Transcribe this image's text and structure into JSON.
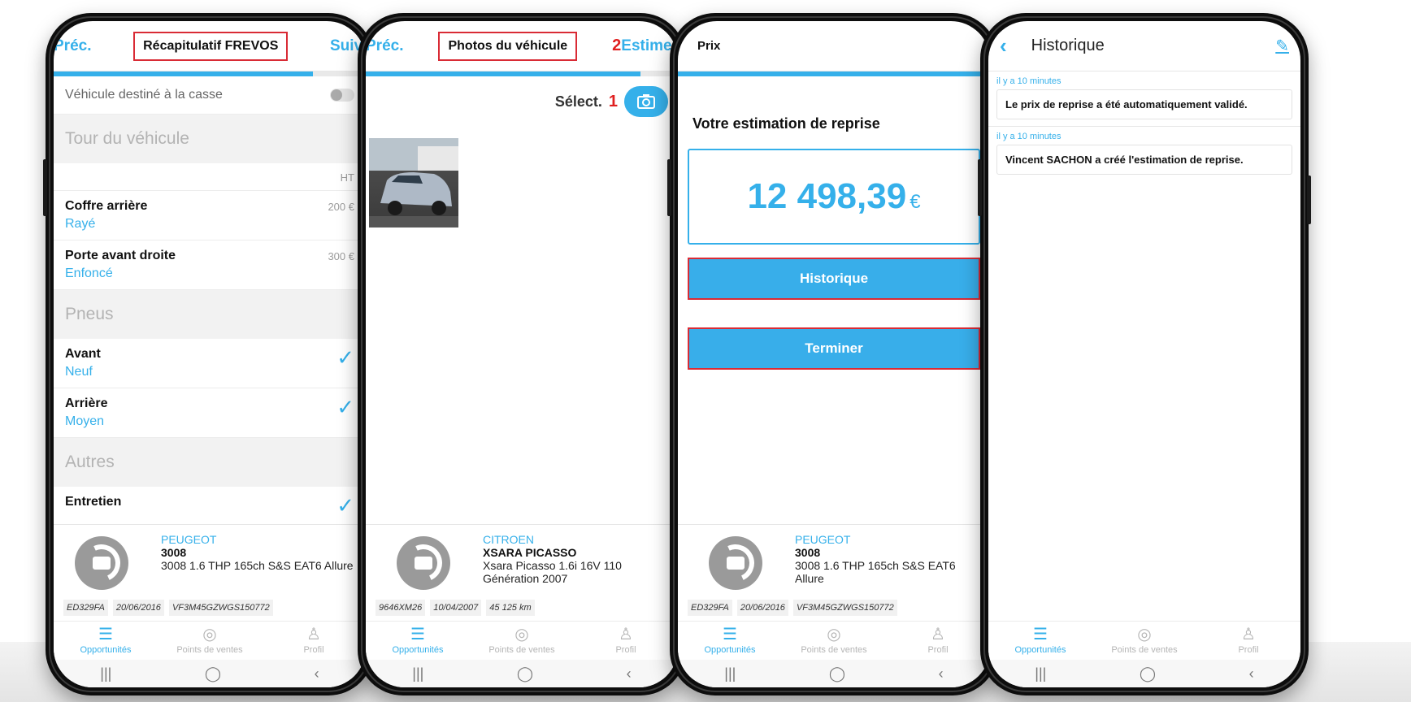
{
  "phone1": {
    "prev": "Préc.",
    "title": "Récapitulatif FREVOS",
    "next": "Suiv.",
    "toggle_label": "Véhicule destiné à la casse",
    "section_tour": "Tour du véhicule",
    "ht": "HT",
    "items": [
      {
        "title": "Coffre arrière",
        "status": "Rayé",
        "price": "200 €"
      },
      {
        "title": "Porte avant droite",
        "status": "Enfoncé",
        "price": "300 €"
      }
    ],
    "section_pneus": "Pneus",
    "pneus": [
      {
        "title": "Avant",
        "status": "Neuf"
      },
      {
        "title": "Arrière",
        "status": "Moyen"
      }
    ],
    "section_autres": "Autres",
    "autres": [
      {
        "title": "Entretien"
      }
    ],
    "vehicle": {
      "brand": "PEUGEOT",
      "model": "3008",
      "desc": "3008 1.6 THP 165ch S&S EAT6 Allure",
      "plate": "ED329FA",
      "date": "20/06/2016",
      "vin": "VF3M45GZWGS150772"
    },
    "progress": 0.83
  },
  "phone2": {
    "prev": "Préc.",
    "title": "Photos du véhicule",
    "step_next": "2",
    "next": "Estimer",
    "select_label": "Sélect.",
    "step_select": "1",
    "vehicle": {
      "brand": "CITROEN",
      "model": "XSARA PICASSO",
      "desc": "Xsara Picasso 1.6i 16V 110 Génération 2007",
      "plate": "9646XM26",
      "date": "10/04/2007",
      "km": "45 125 km"
    },
    "progress": 0.88
  },
  "phone3": {
    "title": "Prix",
    "heading": "Votre estimation de reprise",
    "price": "12 498,39",
    "currency": "€",
    "btn_history": "Historique",
    "btn_finish": "Terminer",
    "vehicle": {
      "brand": "PEUGEOT",
      "model": "3008",
      "desc": "3008 1.6 THP 165ch S&S EAT6 Allure",
      "plate": "ED329FA",
      "date": "20/06/2016",
      "vin": "VF3M45GZWGS150772"
    },
    "progress": 1.0
  },
  "phone4": {
    "title": "Historique",
    "entries": [
      {
        "time": "il y a 10 minutes",
        "text": "Le prix de reprise a été automatiquement validé."
      },
      {
        "time": "il y a 10 minutes",
        "text": "Vincent SACHON a créé l'estimation de reprise."
      }
    ]
  },
  "tabs": {
    "opportunites": "Opportunités",
    "points": "Points de ventes",
    "profil": "Profil"
  },
  "sysnav": {
    "recent": "|||",
    "home": "◯",
    "back": "‹"
  },
  "colors": {
    "accent": "#35b0ea",
    "highlight": "#d92b35"
  }
}
